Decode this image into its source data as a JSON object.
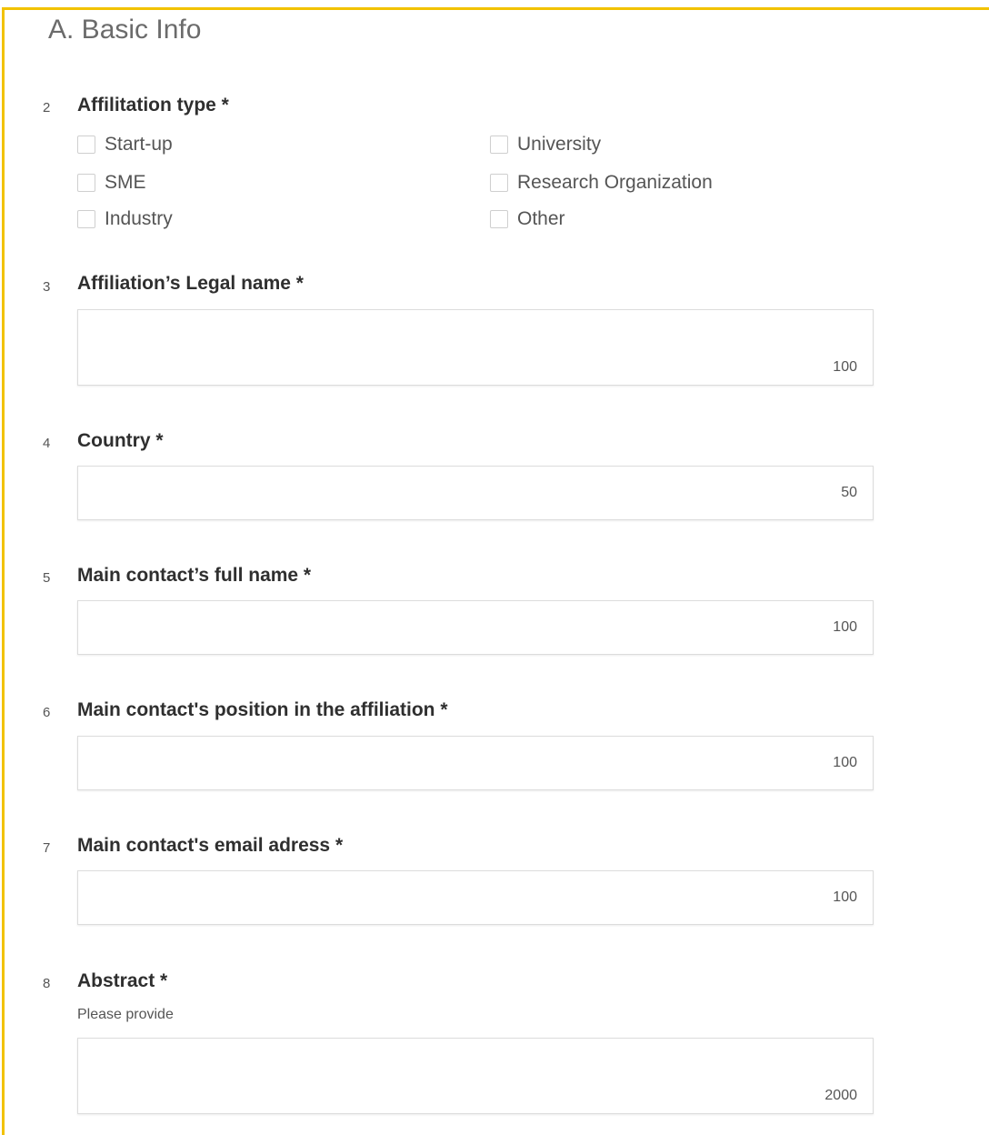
{
  "section": {
    "title": "A. Basic Info"
  },
  "affiliation_type": {
    "num": "2",
    "label": "Affilitation type *",
    "options": [
      {
        "label": "Start-up",
        "checked": false
      },
      {
        "label": "University",
        "checked": false
      },
      {
        "label": "SME",
        "checked": false
      },
      {
        "label": "Research Organization",
        "checked": false
      },
      {
        "label": "Industry",
        "checked": false
      },
      {
        "label": "Other",
        "checked": false
      }
    ]
  },
  "legal_name": {
    "num": "3",
    "label": "Affiliation’s Legal name *",
    "value": "",
    "counter": "100"
  },
  "country": {
    "num": "4",
    "label": "Country *",
    "value": "",
    "counter": "50"
  },
  "full_name": {
    "num": "5",
    "label": "Main contact’s full name *",
    "value": "",
    "counter": "100"
  },
  "position": {
    "num": "6",
    "label": "Main contact's position in the affiliation *",
    "value": "",
    "counter": "100"
  },
  "email": {
    "num": "7",
    "label": "Main contact's email adress *",
    "value": "",
    "counter": "100"
  },
  "abstract": {
    "num": "8",
    "label": "Abstract *",
    "hint": "Please provide",
    "value": "",
    "counter": "2000"
  }
}
